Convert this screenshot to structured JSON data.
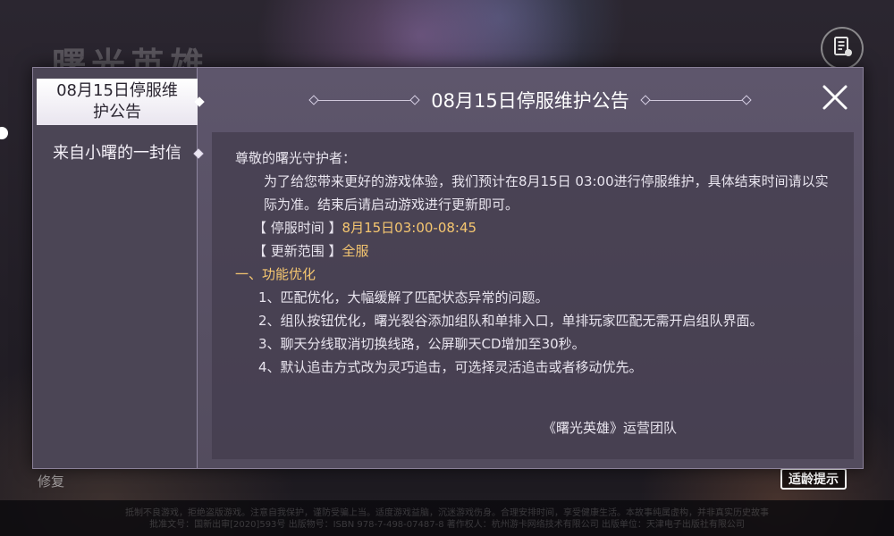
{
  "background": {
    "game_logo": "曙光英雄",
    "repair_label": "修复",
    "age_badge": "适龄提示",
    "footer_line1": "抵制不良游戏，拒绝盗版游戏。注意自我保护，谨防受骗上当。适度游戏益脑，沉迷游戏伤身。合理安排时间，享受健康生活。本故事纯属虚构，并非真实历史故事",
    "footer_line2": "批准文号：国新出审[2020]593号 出版物号：ISBN 978-7-498-07487-8 著作权人：杭州游卡网络技术有限公司 出版单位：天津电子出版社有限公司"
  },
  "sidebar": {
    "items": [
      {
        "label": "08月15日停服维护公告",
        "active": true
      },
      {
        "label": "来自小曙的一封信",
        "active": false
      }
    ]
  },
  "dialog": {
    "title": "08月15日停服维护公告"
  },
  "content": {
    "greeting": "尊敬的曙光守护者：",
    "intro": "为了给您带来更好的游戏体验，我们预计在8月15日 03:00进行停服维护，具体结束时间请以实际为准。结束后请启动游戏进行更新即可。",
    "time_label": "【 停服时间 】",
    "time_value": "8月15日03:00-08:45",
    "scope_label": "【 更新范围 】",
    "scope_value": "全服",
    "section_title": "一、功能优化",
    "items": [
      "1、匹配优化，大幅缓解了匹配状态异常的问题。",
      "2、组队按钮优化，曙光裂谷添加组队和单排入口，单排玩家匹配无需开启组队界面。",
      "3、聊天分线取消切换线路，公屏聊天CD增加至30秒。",
      "4、默认追击方式改为灵巧追击，可选择灵活追击或者移动优先。"
    ],
    "signature": "《曙光英雄》运营团队"
  },
  "colors": {
    "highlight": "#f6c770",
    "dialog_bg": "#5a5268",
    "sidebar_active_bg": "#ffffff"
  }
}
